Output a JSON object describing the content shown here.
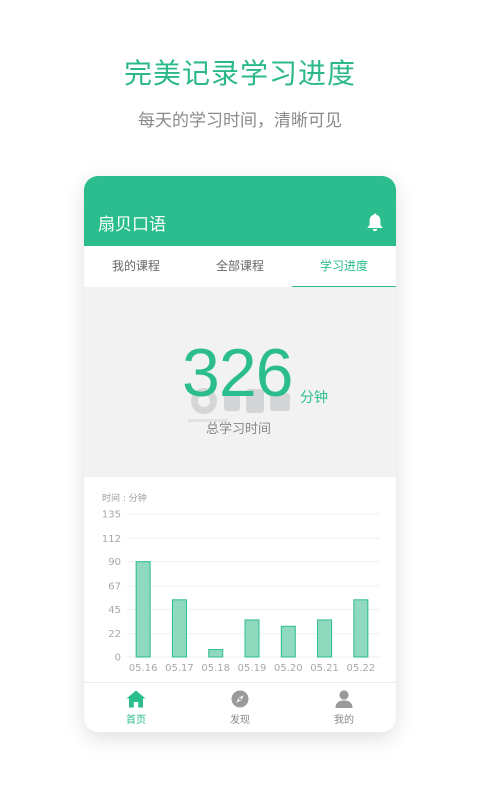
{
  "promo": {
    "headline": "完美记录学习进度",
    "subline": "每天的学习时间，清晰可见"
  },
  "app": {
    "title": "扇贝口语",
    "tabs": [
      {
        "label": "我的课程",
        "active": false
      },
      {
        "label": "全部课程",
        "active": false
      },
      {
        "label": "学习进度",
        "active": true
      }
    ],
    "summary": {
      "total_minutes": "326",
      "unit": "分钟",
      "label": "总学习时间"
    },
    "bottom_nav": [
      {
        "label": "首页",
        "icon": "home-icon",
        "active": true
      },
      {
        "label": "发现",
        "icon": "compass-icon",
        "active": false
      },
      {
        "label": "我的",
        "icon": "user-icon",
        "active": false
      }
    ]
  },
  "colors": {
    "accent": "#2bbd8e",
    "bar_fill": "#8fd9bf",
    "bar_stroke": "#2bbd8e"
  },
  "chart_data": {
    "type": "bar",
    "ylabel": "时间 : 分钟",
    "categories": [
      "05.16",
      "05.17",
      "05.18",
      "05.19",
      "05.20",
      "05.21",
      "05.22"
    ],
    "values": [
      90,
      54,
      7,
      35,
      29,
      35,
      54
    ],
    "yticks": [
      135,
      112,
      90,
      67,
      45,
      22,
      0
    ],
    "ylim": [
      0,
      135
    ],
    "grid": true,
    "legend": "none"
  }
}
